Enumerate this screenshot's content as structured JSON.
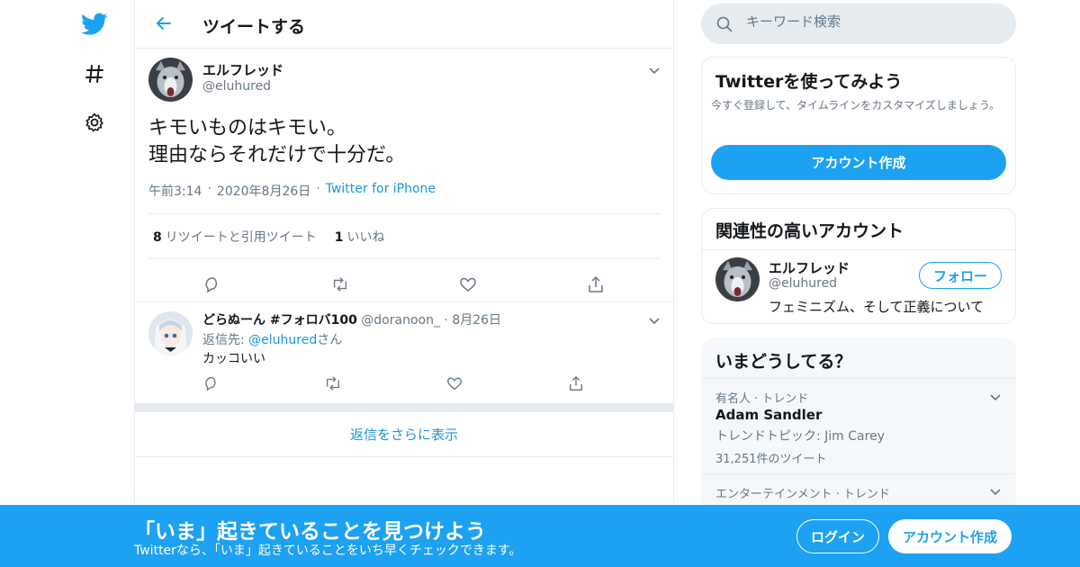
{
  "colors": {
    "accent": "#1da1f2",
    "link": "#1b95e0",
    "muted": "#657786",
    "border": "#e6ecf0"
  },
  "nav": {
    "icons": [
      "twitter-logo-icon",
      "hashtag-icon",
      "settings-gear-icon"
    ]
  },
  "header": {
    "title": "ツイートする",
    "back_icon": "arrow-left-icon"
  },
  "tweet": {
    "author_name": "エルフレッド",
    "author_handle": "@eluhured",
    "text_line1": "キモいものはキモい。",
    "text_line2": "理由ならそれだけで十分だ。",
    "time": "午前3:14",
    "date": "2020年8月26日",
    "source": "Twitter for iPhone",
    "retweets_count": "8",
    "retweets_label": "リツイートと引用ツイート",
    "likes_count": "1",
    "likes_label": "いいね"
  },
  "reply": {
    "name": "どらぬーん #フォロバ100",
    "handle": "@doranoon_",
    "date": "8月26日",
    "replying_prefix": "返信先: ",
    "replying_to": "@eluhured",
    "replying_suffix": "さん",
    "text": "カッコいい"
  },
  "show_more": "返信をさらに表示",
  "search": {
    "placeholder": "キーワード検索"
  },
  "signup_card": {
    "title": "Twitterを使ってみよう",
    "description": "今すぐ登録して、タイムラインをカスタマイズしましょう。",
    "button": "アカウント作成"
  },
  "related": {
    "title": "関連性の高いアカウント",
    "name": "エルフレッド",
    "handle": "@eluhured",
    "bio": "フェミニズム、そして正義について",
    "follow": "フォロー"
  },
  "trends": {
    "title": "いまどうしてる？",
    "items": [
      {
        "category": "有名人 · トレンド",
        "name": "Adam Sandler",
        "topic": "トレンドトピック: Jim Carey",
        "count": "31,251件のツイート"
      },
      {
        "category": "エンターテインメント · トレンド"
      }
    ]
  },
  "bottom_bar": {
    "title": "「いま」起きていることを見つけよう",
    "subtitle": "Twitterなら、「いま」起きていることをいち早くチェックできます。",
    "login": "ログイン",
    "signup": "アカウント作成"
  }
}
